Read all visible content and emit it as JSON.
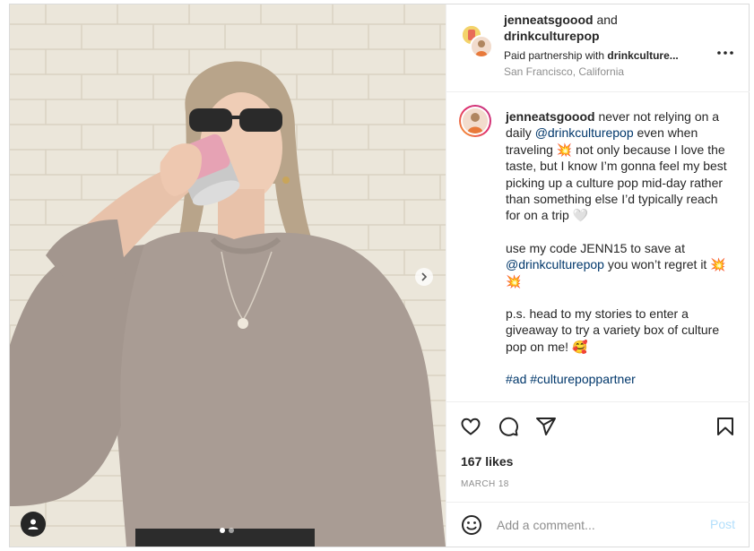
{
  "post": {
    "author_primary": "jenneatsgoood",
    "and_word": "and",
    "author_secondary": "drinkculturepop",
    "partnership_prefix": "Paid partnership with",
    "partnership_brand": "drinkculture...",
    "location": "San Francisco, California",
    "more_icon": "more-horizontal-icon"
  },
  "caption": {
    "username": "jenneatsgoood",
    "p1_a": " never not relying on a daily ",
    "mention1": "@drinkculturepop",
    "p1_b": " even when traveling 💥 not only because I love the taste, but I know I’m gonna feel my best picking up a culture pop mid-day rather than something else I’d typically reach for on a trip 🤍",
    "p2_a": "use my code JENN15 to save at ",
    "mention2": "@drinkculturepop",
    "p2_b": " you won’t regret it 💥 💥",
    "p3": "p.s. head to my stories to enter a giveaway to try a variety box of culture pop on me! 🥰",
    "hashtag1": "#ad",
    "hashtag2": "#culturepoppartner"
  },
  "actions": {
    "icons": [
      "heart-icon",
      "comment-icon",
      "share-icon",
      "bookmark-icon"
    ],
    "likes": "167 likes",
    "date": "MARCH 18"
  },
  "comment": {
    "placeholder": "Add a comment...",
    "post_label": "Post",
    "post_color": "#b2dffc"
  },
  "media": {
    "carousel_count": 2,
    "carousel_active": 1
  },
  "colors": {
    "link": "#00376b",
    "muted": "#8e8e8e",
    "border": "#dbdbdb"
  }
}
